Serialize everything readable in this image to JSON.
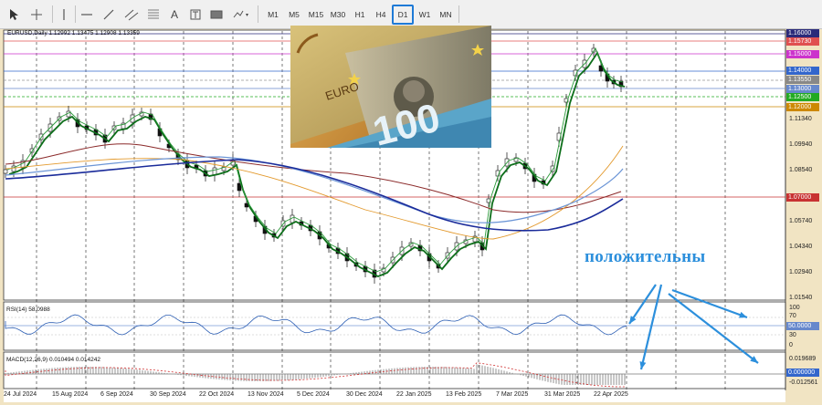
{
  "toolbar": {
    "tools": [
      {
        "name": "cursor-icon"
      },
      {
        "name": "crosshair-icon"
      },
      {
        "name": "vertical-line-icon"
      },
      {
        "name": "horizontal-line-icon"
      },
      {
        "name": "trendline-icon"
      },
      {
        "name": "channel-icon"
      },
      {
        "name": "fibonacci-icon"
      },
      {
        "name": "text-icon"
      },
      {
        "name": "rectangle-icon"
      },
      {
        "name": "shapes-menu-icon"
      }
    ],
    "timeframes": [
      "M1",
      "M5",
      "M15",
      "M30",
      "H1",
      "H4",
      "D1",
      "W1",
      "MN"
    ],
    "active_timeframe": "D1"
  },
  "chart": {
    "symbol_header": "EURUSD,Daily  1.12992 1.13475 1.12908 1.13359",
    "price_axis": [
      "1.16000",
      "1.15730",
      "1.15000",
      "1.14000",
      "1.13550",
      "1.13000",
      "1.12500",
      "1.12000",
      "1.11340",
      "1.09940",
      "1.08540",
      "1.07000",
      "1.05740",
      "1.04340",
      "1.02940",
      "1.01540"
    ],
    "price_labels": [
      {
        "text": "1.16000",
        "color": "#2a2a7a"
      },
      {
        "text": "1.15730",
        "color": "#e05050"
      },
      {
        "text": "1.15000",
        "color": "#cc33cc"
      },
      {
        "text": "1.14000",
        "color": "#3366cc"
      },
      {
        "text": "1.13550",
        "color": "#888888"
      },
      {
        "text": "1.13000",
        "color": "#6688cc"
      },
      {
        "text": "1.12500",
        "color": "#22aa22"
      },
      {
        "text": "1.12000",
        "color": "#cc8800"
      },
      {
        "text": "1.07000",
        "color": "#c83232"
      }
    ],
    "price_axis_plain": [
      "1.11340",
      "1.09940",
      "1.08540",
      "1.05740",
      "1.04340",
      "1.02940",
      "1.01540"
    ],
    "dates": [
      "24 Jul 2024",
      "15 Aug 2024",
      "6 Sep 2024",
      "30 Sep 2024",
      "22 Oct 2024",
      "13 Nov 2024",
      "5 Dec 2024",
      "30 Dec 2024",
      "22 Jan 2025",
      "13 Feb 2025",
      "7 Mar 2025",
      "31 Mar 2025",
      "22 Apr 2025"
    ]
  },
  "rsi": {
    "label": "RSI(14) 58.0988",
    "axis": [
      "100",
      "70",
      "50.0000",
      "30",
      "0"
    ],
    "level_label": "50.0000"
  },
  "macd": {
    "label": "MACD(12,26,9) 0.010494 0.014242",
    "axis": [
      "0.019689",
      "0.000000",
      "-0.012561"
    ],
    "zero_label": "0.000000"
  },
  "annotation": {
    "text": "положительны",
    "color": "#2c8fdc"
  },
  "photo": {
    "description_icon": "euro-dollar-banknotes-image",
    "euro_text": "EURO",
    "dollar_text": "100"
  }
}
